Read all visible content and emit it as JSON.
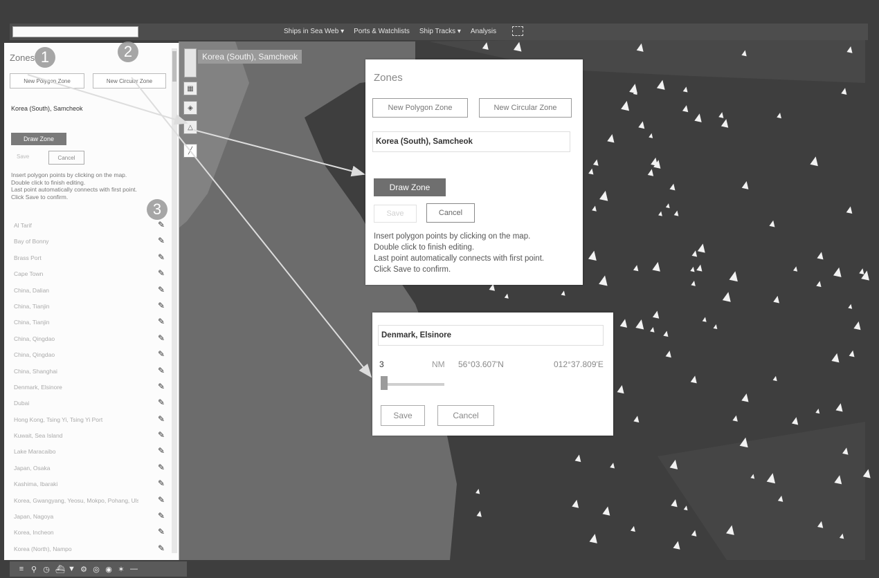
{
  "topbar": {
    "menu": [
      "Ships in Sea Web ▾",
      "Ports & Watchlists",
      "Ship Tracks ▾",
      "Analysis"
    ]
  },
  "location_label": "Korea (South), Samcheok",
  "left_panel": {
    "title": "Zones",
    "new_polygon_zone": "New Polygon Zone",
    "new_circular_zone": "New Circular Zone",
    "zone_name": "Korea (South), Samcheok",
    "draw_zone": "Draw Zone",
    "save": "Save",
    "cancel": "Cancel",
    "instructions": [
      "Insert polygon points by clicking on the map.",
      "Double click to finish editing.",
      "Last point automatically connects with first point.",
      "Click Save to confirm."
    ],
    "zones": [
      {
        "name": "Al Tarif"
      },
      {
        "name": "Bay of Bonny"
      },
      {
        "name": "Brass Port"
      },
      {
        "name": "Cape Town"
      },
      {
        "name": "China, Dalian"
      },
      {
        "name": "China, Tianjin"
      },
      {
        "name": "China, Tianjin"
      },
      {
        "name": "China, Qingdao"
      },
      {
        "name": "China, Qingdao"
      },
      {
        "name": "China, Shanghai"
      },
      {
        "name": "Denmark, Elsinore"
      },
      {
        "name": "Dubai"
      },
      {
        "name": "Hong Kong, Tsing Yi, Tsing Yi Port"
      },
      {
        "name": "Kuwait, Sea Island"
      },
      {
        "name": "Lake Maracaibo"
      },
      {
        "name": "Japan, Osaka"
      },
      {
        "name": "Kashima, Ibaraki"
      },
      {
        "name": "Korea, Gwangyang, Yeosu, Mokpo, Pohang, Ulsan, Busan"
      },
      {
        "name": "Japan, Nagoya"
      },
      {
        "name": "Korea, Incheon"
      },
      {
        "name": "Korea (North), Nampo"
      }
    ]
  },
  "zones_panel": {
    "title": "Zones",
    "new_polygon_zone": "New Polygon Zone",
    "new_circular_zone": "New Circular Zone",
    "zone_name": "Korea (South), Samcheok",
    "draw_zone": "Draw Zone",
    "save": "Save",
    "cancel": "Cancel",
    "instructions": [
      "Insert polygon points by clicking on the map.",
      "Double click to finish editing.",
      "Last point automatically connects with first point.",
      "Click Save to confirm."
    ]
  },
  "circle_panel": {
    "zone_name": "Denmark, Elsinore",
    "radius": "3",
    "unit": "NM",
    "lat": "56°03.607'N",
    "lon": "012°37.809'E",
    "save": "Save",
    "cancel": "Cancel"
  },
  "callouts": [
    "1",
    "2",
    "3"
  ],
  "icons": {
    "edit": "pencil-icon",
    "bottom_toolbar": [
      "list-icon",
      "search-icon",
      "clock-icon",
      "ship-icon",
      "filter-icon",
      "gear-icon",
      "settings-icon",
      "globe-icon",
      "star-icon",
      "minus-icon"
    ]
  },
  "colors": {
    "sea": "#3d3d3d",
    "land": "#6f6f6f",
    "panel_bg": "#ffffff",
    "draw_button": "#6f6f6f",
    "callout": "#969696"
  }
}
